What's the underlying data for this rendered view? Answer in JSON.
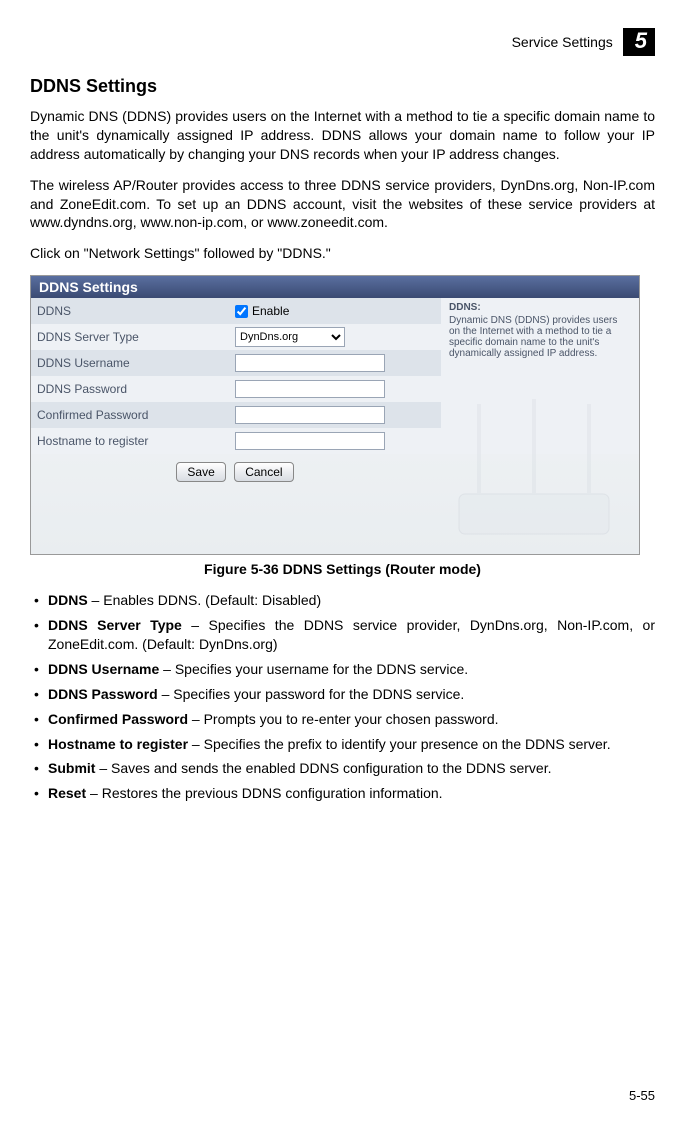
{
  "header": {
    "breadcrumb": "Service Settings",
    "chapter": "5"
  },
  "title": "DDNS Settings",
  "paragraphs": {
    "p1": "Dynamic DNS (DDNS) provides users on the Internet with a method to tie a specific domain name to the unit's dynamically assigned IP address. DDNS allows your domain name to follow your IP address automatically by changing your DNS records when your IP address changes.",
    "p2": "The wireless AP/Router provides access to three DDNS service providers, DynDns.org, Non-IP.com and ZoneEdit.com. To set up an DDNS account, visit the websites of these service providers at www.dyndns.org, www.non-ip.com, or www.zoneedit.com.",
    "p3": "Click on \"Network Settings\" followed by \"DDNS.\""
  },
  "ui": {
    "panel_title": "DDNS Settings",
    "rows": {
      "ddns": "DDNS",
      "enable": "Enable",
      "server_type": "DDNS Server Type",
      "server_value": "DynDns.org",
      "username": "DDNS Username",
      "password": "DDNS Password",
      "confirmed": "Confirmed Password",
      "hostname": "Hostname to register"
    },
    "help": {
      "title": "DDNS:",
      "body": "Dynamic DNS (DDNS) provides users on the Internet with a method to tie a specific domain name to the unit's dynamically assigned IP address."
    },
    "buttons": {
      "save": "Save",
      "cancel": "Cancel"
    }
  },
  "figure_caption": "Figure 5-36  DDNS Settings (Router mode)",
  "bullets": [
    {
      "term": "DDNS",
      "desc": " – Enables DDNS. (Default: Disabled)"
    },
    {
      "term": "DDNS Server Type",
      "desc": " – Specifies the DDNS service provider, DynDns.org, Non-IP.com, or ZoneEdit.com. (Default: DynDns.org)"
    },
    {
      "term": "DDNS Username",
      "desc": " – Specifies your username for the DDNS service."
    },
    {
      "term": "DDNS Password",
      "desc": " – Specifies your password for the DDNS service."
    },
    {
      "term": "Confirmed Password",
      "desc": " – Prompts you to re-enter your chosen password."
    },
    {
      "term": "Hostname to register",
      "desc": " – Specifies the prefix to identify your presence on the DDNS server."
    },
    {
      "term": "Submit",
      "desc": " – Saves and sends the enabled DDNS configuration to the DDNS server."
    },
    {
      "term": "Reset",
      "desc": " – Restores the previous DDNS configuration information."
    }
  ],
  "page_number": "5-55"
}
